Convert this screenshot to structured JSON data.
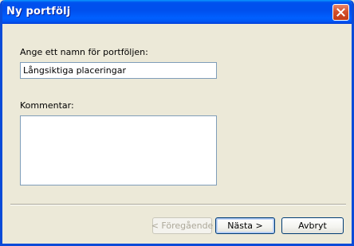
{
  "window": {
    "title": "Ny portfölj",
    "close_icon": "close-icon"
  },
  "form": {
    "name_label": "Ange ett namn för portföljen:",
    "name_value": "Långsiktiga placeringar",
    "comment_label": "Kommentar:",
    "comment_value": ""
  },
  "buttons": {
    "back_label": "< Föregående",
    "next_label": "Nästa >",
    "cancel_label": "Avbryt"
  },
  "colors": {
    "titlebar": "#0050EE",
    "dialog_bg": "#ECE9D8",
    "input_border": "#7F9DB9"
  }
}
